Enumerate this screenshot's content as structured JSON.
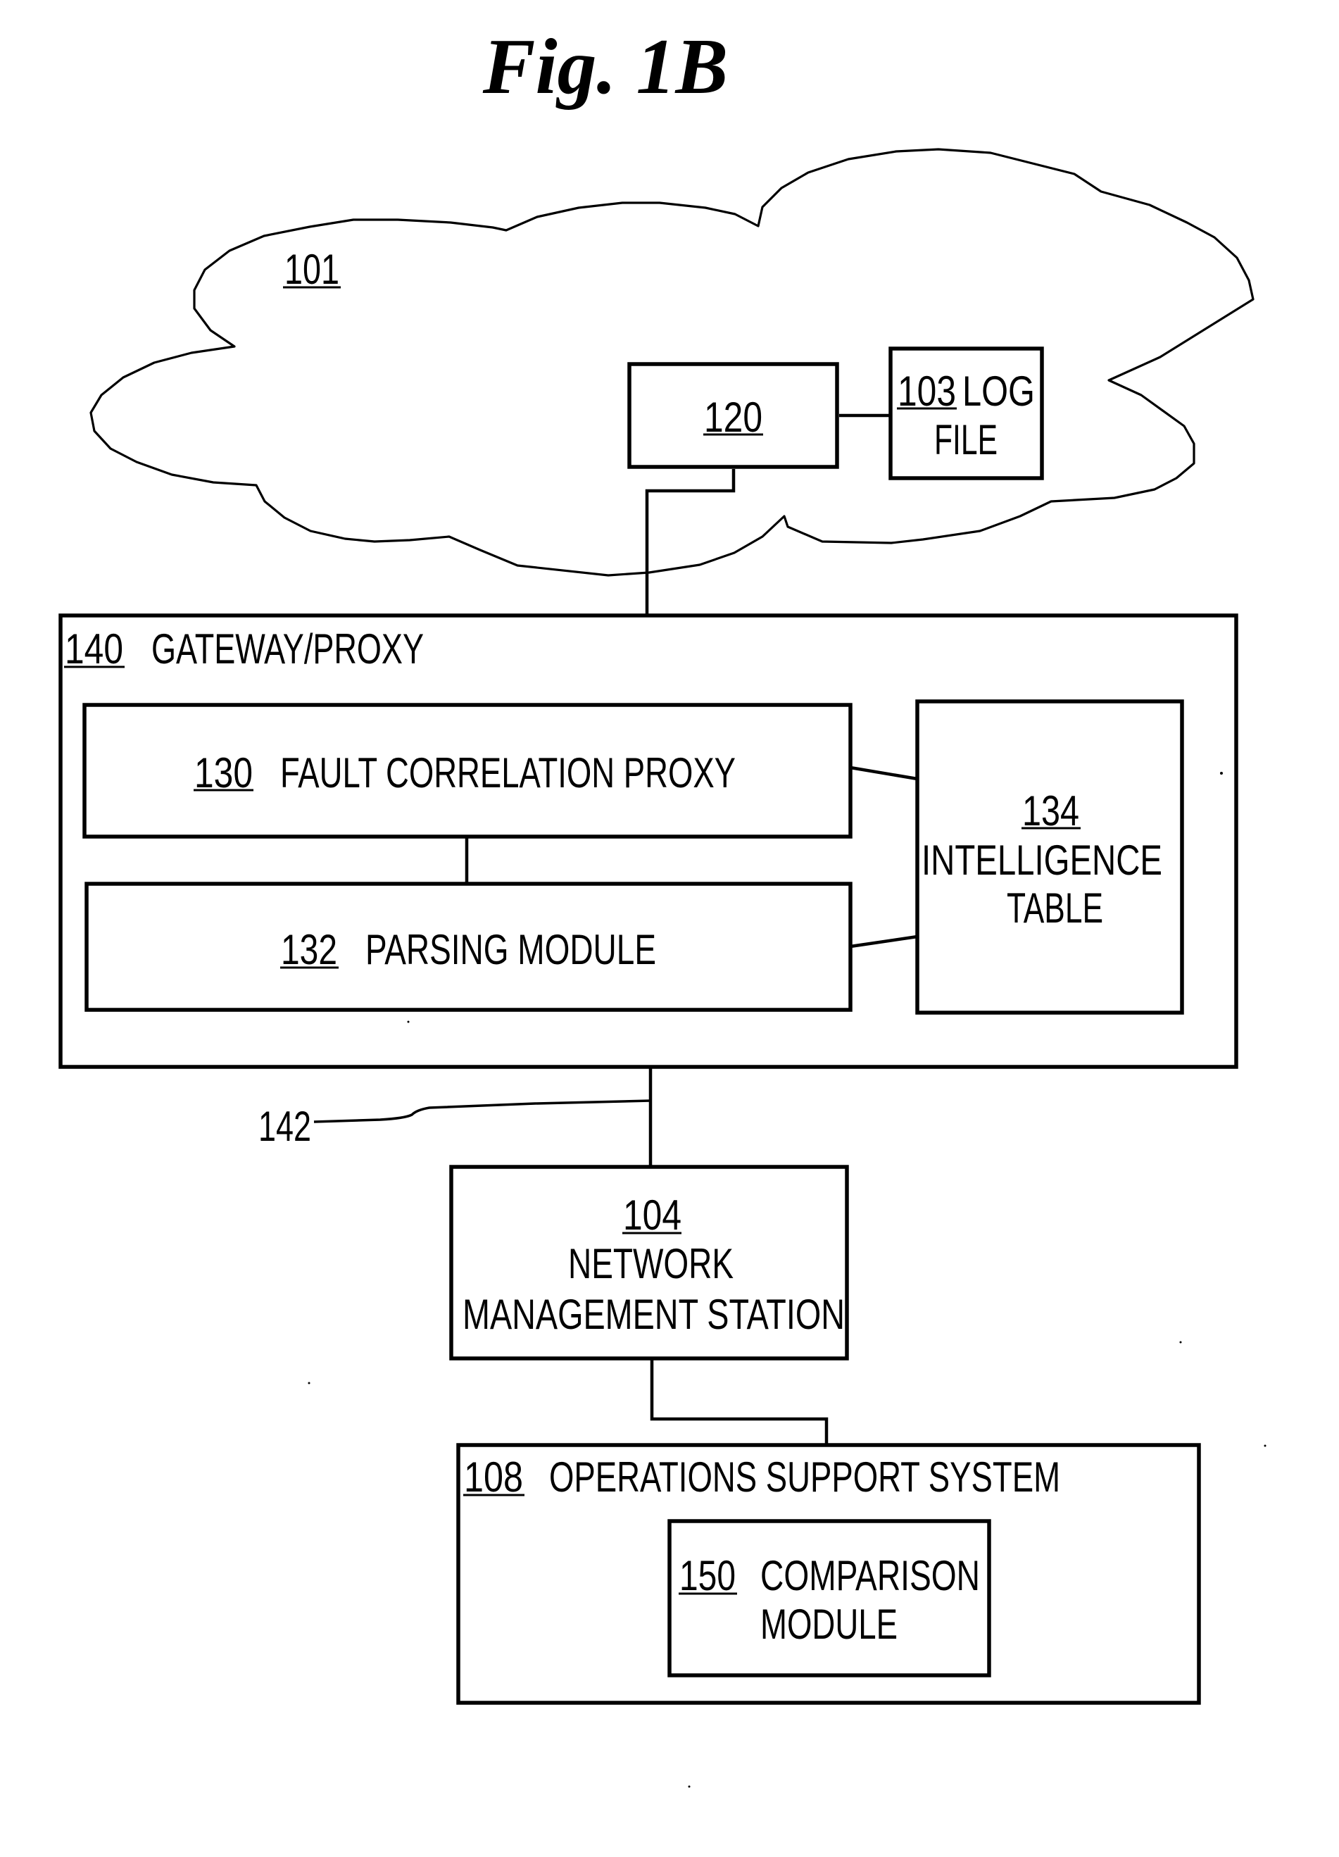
{
  "figure": {
    "title": "Fig. 1B"
  },
  "network_cloud": {
    "ref": "101"
  },
  "device": {
    "ref": "120"
  },
  "log_file": {
    "ref": "103",
    "line1": "LOG",
    "line2": "FILE"
  },
  "gateway": {
    "ref": "140",
    "label": "GATEWAY/PROXY",
    "fault_correlation_proxy": {
      "ref": "130",
      "label": "FAULT CORRELATION PROXY"
    },
    "parsing_module": {
      "ref": "132",
      "label": "PARSING MODULE"
    },
    "intelligence_table": {
      "ref": "134",
      "line1": "INTELLIGENCE",
      "line2": "TABLE"
    }
  },
  "link": {
    "ref": "142"
  },
  "network_management_station": {
    "ref": "104",
    "line1": "NETWORK",
    "line2": "MANAGEMENT STATION"
  },
  "operations_support_system": {
    "ref": "108",
    "label": "OPERATIONS SUPPORT SYSTEM",
    "comparison_module": {
      "ref": "150",
      "line1": "COMPARISON",
      "line2": "MODULE"
    }
  }
}
